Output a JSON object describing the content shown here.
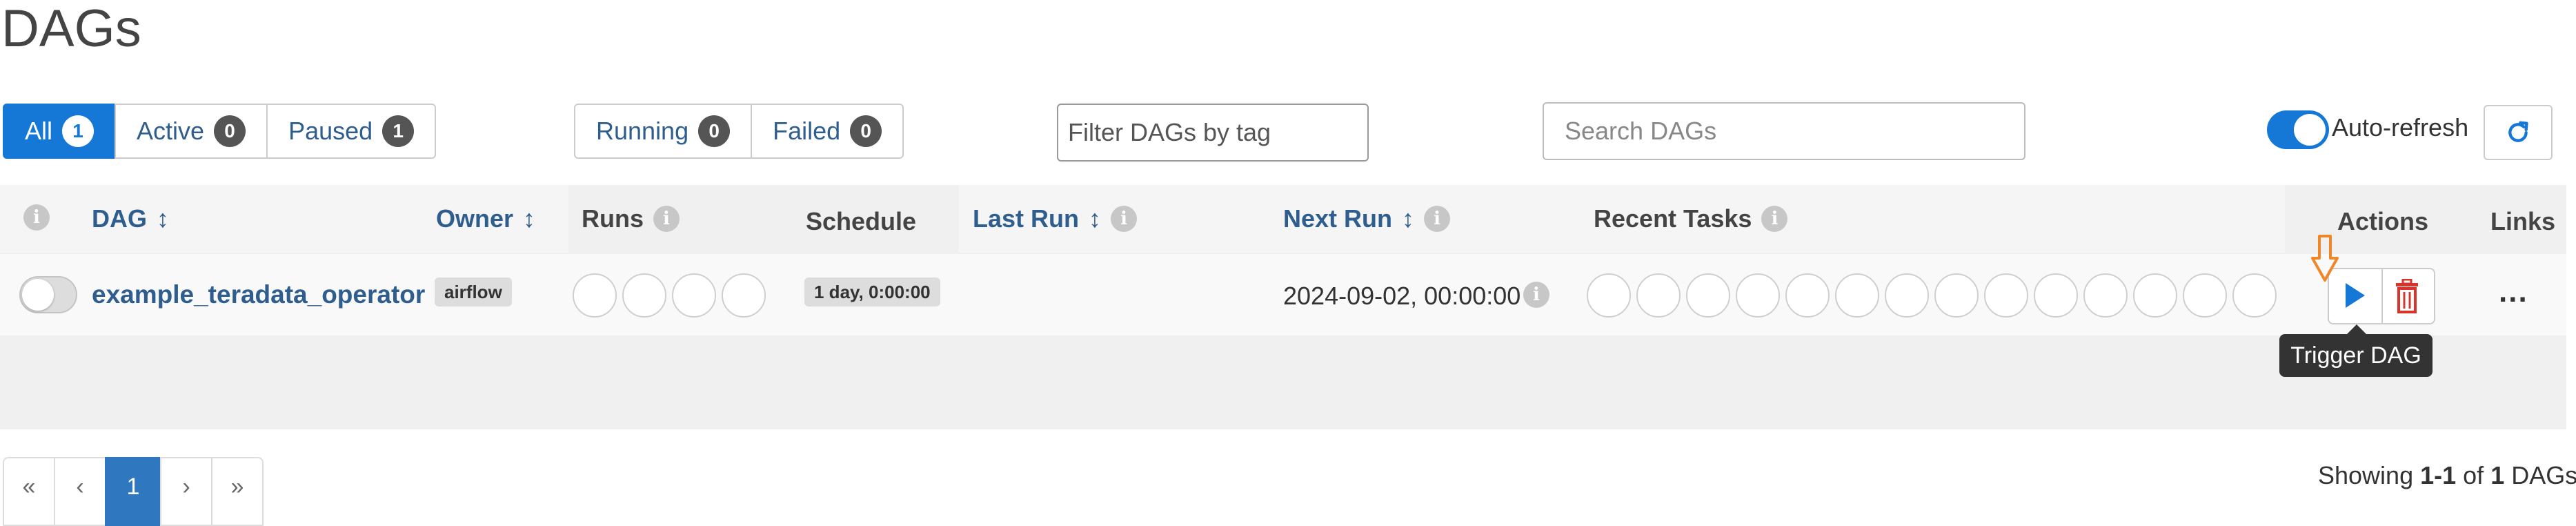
{
  "page": {
    "title": "DAGs"
  },
  "status_filter": {
    "all": {
      "label": "All",
      "count": "1"
    },
    "active": {
      "label": "Active",
      "count": "0"
    },
    "paused": {
      "label": "Paused",
      "count": "1"
    }
  },
  "run_filter": {
    "running": {
      "label": "Running",
      "count": "0"
    },
    "failed": {
      "label": "Failed",
      "count": "0"
    }
  },
  "tag_filter": {
    "placeholder": "Filter DAGs by tag"
  },
  "search": {
    "placeholder": "Search DAGs"
  },
  "auto_refresh": {
    "label": "Auto-refresh",
    "enabled": true
  },
  "table": {
    "headers": {
      "dag": "DAG",
      "owner": "Owner",
      "runs": "Runs",
      "schedule": "Schedule",
      "last_run": "Last Run",
      "next_run": "Next Run",
      "recent_tasks": "Recent Tasks",
      "actions": "Actions",
      "links": "Links"
    },
    "rows": [
      {
        "paused": true,
        "dag_id": "example_teradata_operator",
        "owner": "airflow",
        "schedule": "1 day, 0:00:00",
        "last_run": "",
        "next_run": "2024-09-02, 00:00:00",
        "run_circles": 4,
        "task_circles": 14
      }
    ]
  },
  "actions": {
    "tooltip": "Trigger DAG",
    "more": "..."
  },
  "pagination": {
    "first": "«",
    "prev": "‹",
    "current": "1",
    "next": "›",
    "last": "»"
  },
  "footer": {
    "showing_prefix": "Showing",
    "range": "1-1",
    "of": "of",
    "total": "1",
    "suffix": "DAGs"
  },
  "colors": {
    "primary": "#1577d6",
    "link": "#2f5e8e",
    "delete": "#d9342b",
    "annotation_arrow": "#f0862a"
  },
  "icons": {
    "sort": "sort-icon",
    "info": "info-icon",
    "trigger": "play-icon",
    "delete": "trash-icon",
    "more": "ellipsis-icon",
    "refresh": "refresh-icon"
  }
}
